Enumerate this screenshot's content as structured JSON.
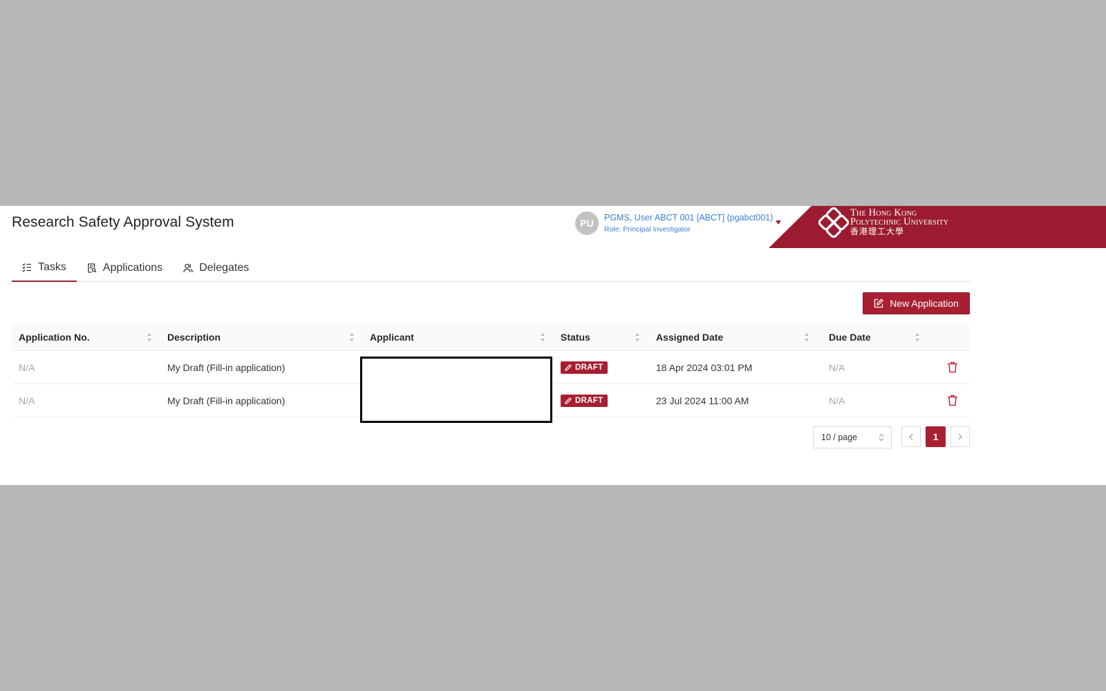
{
  "header": {
    "title": "Research Safety Approval System",
    "user": {
      "initials": "PU",
      "name": "PGMS, User ABCT 001 [ABCT] (pgabct001)",
      "role": "Role: Principal Investigator"
    },
    "logo": {
      "line1": "The Hong Kong",
      "line2": "Polytechnic University",
      "line3": "香港理工大學"
    }
  },
  "tabs": [
    {
      "label": "Tasks",
      "icon": "tasks-list-icon",
      "active": true
    },
    {
      "label": "Applications",
      "icon": "applications-doc-icon",
      "active": false
    },
    {
      "label": "Delegates",
      "icon": "delegates-people-icon",
      "active": false
    }
  ],
  "toolbar": {
    "new_application_label": "New Application"
  },
  "table": {
    "columns": [
      "Application No.",
      "Description",
      "Applicant",
      "Status",
      "Assigned Date",
      "Due Date"
    ],
    "rows": [
      {
        "application_no": "N/A",
        "description": "My Draft (Fill-in application)",
        "applicant": "",
        "status": "DRAFT",
        "assigned_date": "18 Apr 2024 03:01 PM",
        "due_date": "N/A"
      },
      {
        "application_no": "N/A",
        "description": "My Draft (Fill-in application)",
        "applicant": "",
        "status": "DRAFT",
        "assigned_date": "23 Jul 2024 11:00 AM",
        "due_date": "N/A"
      }
    ]
  },
  "pagination": {
    "page_size": "10 / page",
    "current_page": "1"
  },
  "colors": {
    "brand": "#9b1c31",
    "button": "#a81f32",
    "link": "#3a7fd5",
    "backdrop": "#b7b7b7"
  }
}
